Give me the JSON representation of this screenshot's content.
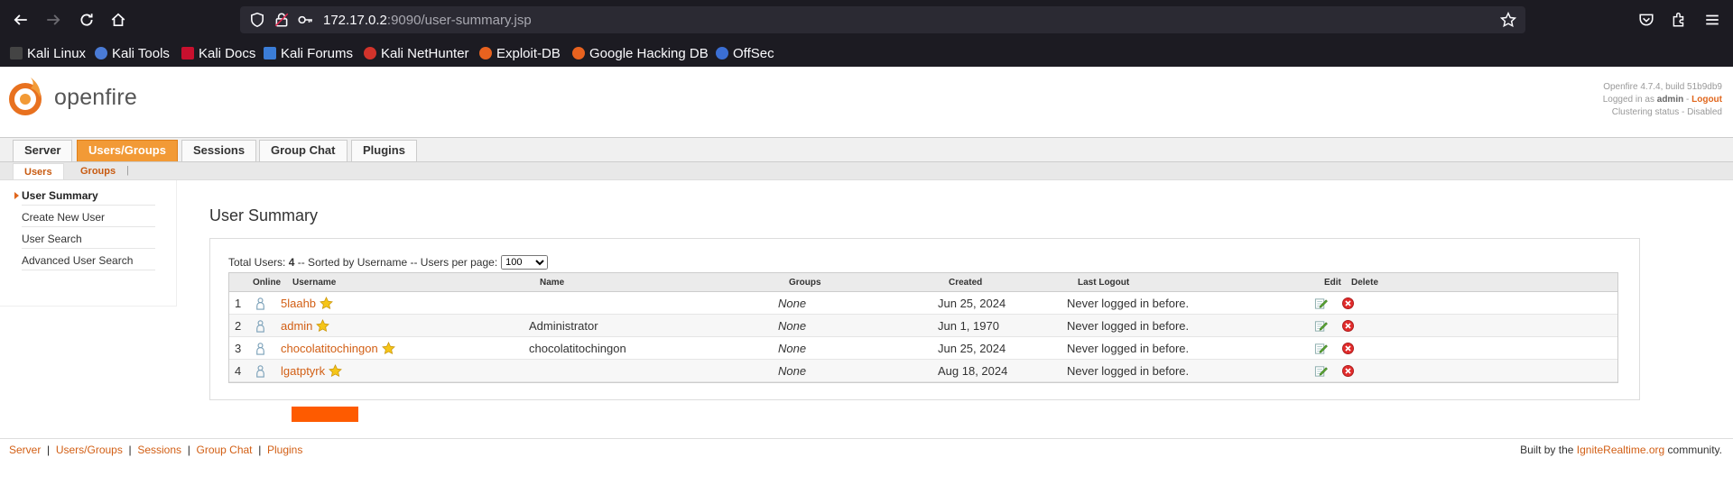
{
  "browser": {
    "url_host": "172.17.0.2",
    "url_path": ":9090/user-summary.jsp",
    "bookmarks": [
      "Kali Linux",
      "Kali Tools",
      "Kali Docs",
      "Kali Forums",
      "Kali NetHunter",
      "Exploit-DB",
      "Google Hacking DB",
      "OffSec"
    ]
  },
  "header": {
    "logo_text": "openfire",
    "version": "Openfire 4.7.4, build 51b9db9",
    "logged_in_prefix": "Logged in as",
    "user": "admin",
    "logout_sep": "-",
    "logout": "Logout",
    "clustering": "Clustering status - Disabled"
  },
  "tabs": [
    "Server",
    "Users/Groups",
    "Sessions",
    "Group Chat",
    "Plugins"
  ],
  "subtabs": [
    "Users",
    "Groups"
  ],
  "subtab_sep": "|",
  "sidebar": [
    "User Summary",
    "Create New User",
    "User Search",
    "Advanced User Search"
  ],
  "title": "User Summary",
  "summary": {
    "prefix": "Total Users:",
    "count": "4",
    "suffix": "-- Sorted by Username -- Users per page:",
    "per_page": "100"
  },
  "table": {
    "headers": [
      "Online",
      "Username",
      "Name",
      "Groups",
      "Created",
      "Last Logout",
      "Edit",
      "Delete"
    ],
    "rows": [
      {
        "n": "1",
        "username": "5laahb",
        "name": "",
        "groups": "None",
        "created": "Jun 25, 2024",
        "logout": "Never logged in before."
      },
      {
        "n": "2",
        "username": "admin",
        "name": "Administrator",
        "groups": "None",
        "created": "Jun 1, 1970",
        "logout": "Never logged in before."
      },
      {
        "n": "3",
        "username": "chocolatitochingon",
        "name": "chocolatitochingon",
        "groups": "None",
        "created": "Jun 25, 2024",
        "logout": "Never logged in before."
      },
      {
        "n": "4",
        "username": "lgatptyrk",
        "name": "",
        "groups": "None",
        "created": "Aug 18, 2024",
        "logout": "Never logged in before."
      }
    ]
  },
  "footer": {
    "links": [
      "Server",
      "Users/Groups",
      "Sessions",
      "Group Chat",
      "Plugins"
    ],
    "sep": "|",
    "built_prefix": "Built by the",
    "built_link": "IgniteRealtime.org",
    "built_suffix": "community."
  },
  "colors": {
    "accent": "#e0661c",
    "tab_active": "#f29a36",
    "browser_bg": "#1c1b22"
  }
}
